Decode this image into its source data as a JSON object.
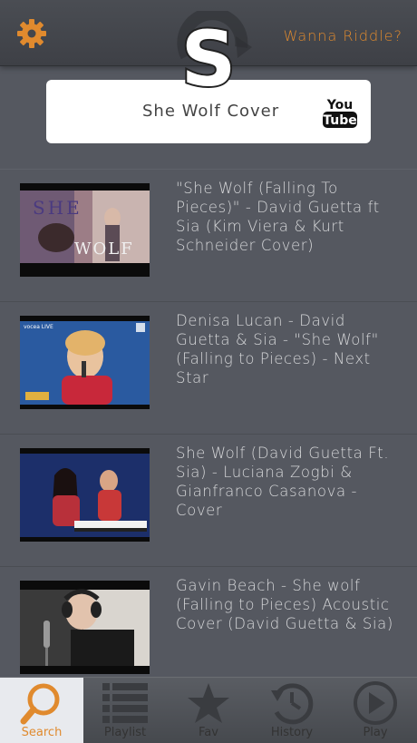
{
  "header": {
    "app_logo_letter": "S",
    "riddle_link": "Wanna Riddle?"
  },
  "search": {
    "query": "She Wolf Cover",
    "source_icon": "youtube-icon"
  },
  "results": [
    {
      "title": "\"She Wolf (Falling To Pieces)\" - David Guetta ft Sia (Kim Viera & Kurt Schneider Cover)",
      "thumb_text_1": "SHE",
      "thumb_text_2": "WOLF"
    },
    {
      "title": "Denisa Lucan - David Guetta & Sia - \"She Wolf\" (Falling to Pieces) - Next Star",
      "thumb_text_1": "vocea LIVE",
      "thumb_text_2": ""
    },
    {
      "title": "She Wolf (David Guetta Ft. Sia) - Luciana Zogbi & Gianfranco Casanova - Cover",
      "thumb_text_1": "",
      "thumb_text_2": ""
    },
    {
      "title": "Gavin Beach - She wolf (Falling to Pieces) Acoustic Cover (David Guetta & Sia)",
      "thumb_text_1": "",
      "thumb_text_2": ""
    }
  ],
  "tabs": [
    {
      "label": "Search",
      "icon": "search-icon",
      "active": true
    },
    {
      "label": "Playlist",
      "icon": "playlist-icon",
      "active": false
    },
    {
      "label": "Fav",
      "icon": "star-icon",
      "active": false
    },
    {
      "label": "History",
      "icon": "history-icon",
      "active": false
    },
    {
      "label": "Play",
      "icon": "play-icon",
      "active": false
    }
  ],
  "colors": {
    "accent": "#e08a2e",
    "background": "#555860",
    "topbar": "#43464c"
  }
}
